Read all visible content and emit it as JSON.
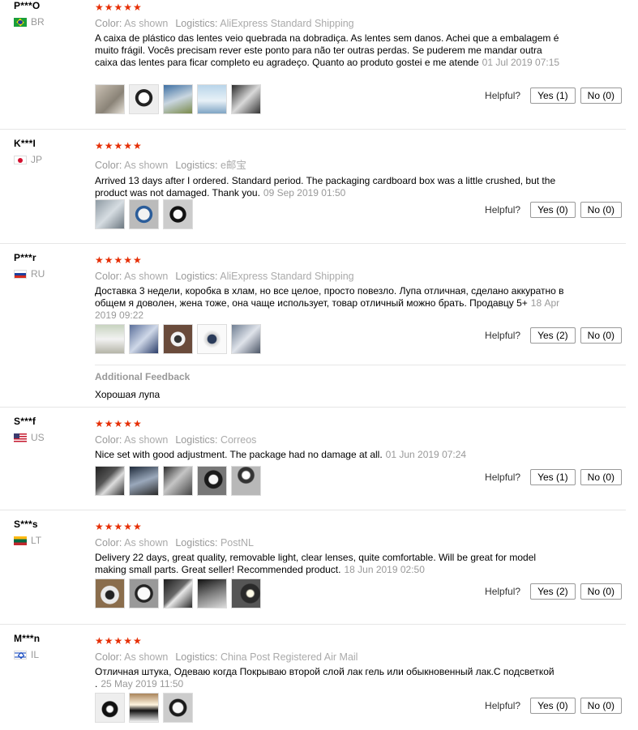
{
  "labels": {
    "color": "Color:",
    "logistics": "Logistics:",
    "helpful": "Helpful?",
    "additional_feedback": "Additional Feedback"
  },
  "reviews": [
    {
      "user": "P***O",
      "country": "BR",
      "stars": "★★★★★",
      "color": "As shown",
      "logistics": "AliExpress Standard Shipping",
      "text": "A caixa de plástico das lentes veio quebrada na dobradiça. As lentes sem danos. Achei que a embalagem é muito frágil. Vocês precisam rever este ponto para não ter outras perdas. Se puderem me mandar outra caixa das lentes para ficar completo eu agradeço. Quanto ao produto gostei e me atende",
      "date": "01 Jul 2019 07:15",
      "yes": "Yes (1)",
      "no": "No (0)"
    },
    {
      "user": "K***I",
      "country": "JP",
      "stars": "★★★★★",
      "color": "As shown",
      "logistics": "e邮宝",
      "text": "Arrived 13 days after I ordered. Standard period. The packaging cardboard box was a little crushed, but the product was not damaged. Thank you.",
      "date": "09 Sep 2019 01:50",
      "yes": "Yes (0)",
      "no": "No (0)"
    },
    {
      "user": "P***r",
      "country": "RU",
      "stars": "★★★★★",
      "color": "As shown",
      "logistics": "AliExpress Standard Shipping",
      "text": "Доставка 3 недели, коробка в хлам, но все целое, просто повезло. Лупа отличная, сделано аккуратно в общем я доволен, жена тоже, она чаще использует, товар отличный можно брать. Продавцу 5+",
      "date": "18 Apr 2019 09:22",
      "yes": "Yes (2)",
      "no": "No (0)",
      "feedback": "Хорошая лупа"
    },
    {
      "user": "S***f",
      "country": "US",
      "stars": "★★★★★",
      "color": "As shown",
      "logistics": "Correos",
      "text": "Nice set with good adjustment. The package had no damage at all.",
      "date": "01 Jun 2019 07:24",
      "yes": "Yes (1)",
      "no": "No (0)"
    },
    {
      "user": "S***s",
      "country": "LT",
      "stars": "★★★★★",
      "color": "As shown",
      "logistics": "PostNL",
      "text": "Delivery 22 days, great quality, removable light, clear lenses, quite comfortable. Will be great for model making small parts. Great seller! Recommended product.",
      "date": "18 Jun 2019 02:50",
      "yes": "Yes (2)",
      "no": "No (0)"
    },
    {
      "user": "M***n",
      "country": "IL",
      "stars": "★★★★★",
      "color": "As shown",
      "logistics": "China Post Registered Air Mail",
      "text": "Отличная штука, Одеваю когда Покрываю второй слой лак гель или обыкновенный лак.С подсветкой .",
      "date": "25 May 2019 11:50",
      "yes": "Yes (0)",
      "no": "No (0)"
    }
  ]
}
